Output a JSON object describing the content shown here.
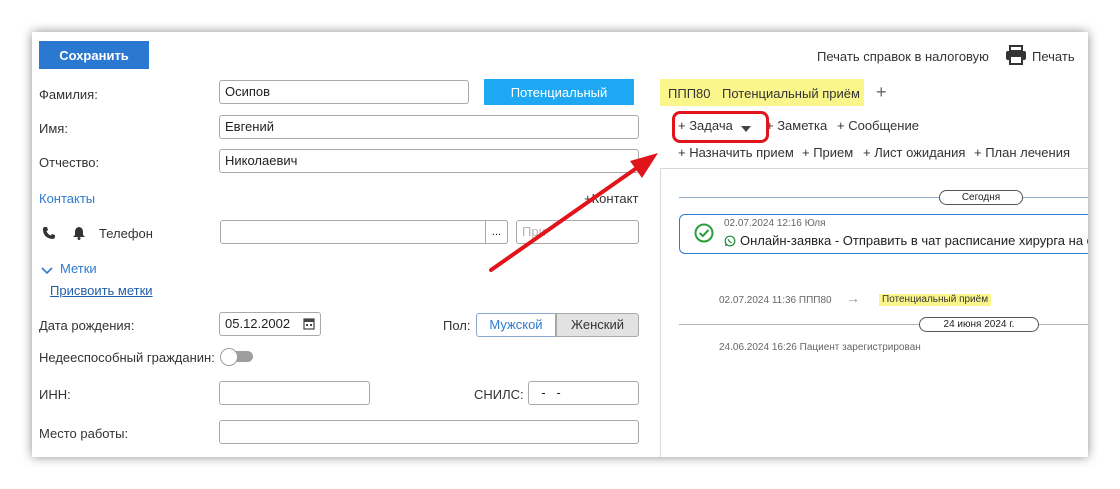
{
  "toolbar": {
    "save_label": "Сохранить",
    "print_tax_label": "Печать справок в налоговую",
    "print_label": "Печать"
  },
  "form": {
    "last_name_label": "Фамилия:",
    "last_name_value": "Осипов",
    "first_name_label": "Имя:",
    "first_name_value": "Евгений",
    "patronymic_label": "Отчество:",
    "patronymic_value": "Николаевич",
    "status_button": "Потенциальный",
    "contacts_label": "Контакты",
    "add_contact_label": "+Контакт",
    "phone_label": "Телефон",
    "phone_value": "",
    "phone_dots": "...",
    "phone_note_placeholder": "При",
    "tags_label": "Метки",
    "assign_tags_label": "Присвоить метки",
    "birth_date_label": "Дата рождения:",
    "birth_date_value": "05.12.2002",
    "gender_label": "Пол:",
    "gender_male": "Мужской",
    "gender_female": "Женский",
    "incapable_label": "Недееспособный гражданин:",
    "inn_label": "ИНН:",
    "inn_value": "",
    "snils_label": "СНИЛС:",
    "snils_value": "  -   -",
    "workplace_label": "Место работы:",
    "workplace_value": ""
  },
  "right": {
    "funnel_tag_code": "ППП80",
    "funnel_tag_name": "Потенциальный приём",
    "add_tag_symbol": "+",
    "actions_row1": [
      "+ Задача",
      "+ Заметка",
      "+ Сообщение"
    ],
    "actions_row2": [
      "+ Назначить прием",
      "+ Прием",
      "+ Лист ожидания",
      "+ План лечения"
    ]
  },
  "timeline": {
    "today_label": "Сегодня",
    "event1_meta": "02.07.2024 12:16 Юля",
    "event1_text": "Онлайн-заявка - Отправить в чат расписание хирурга на с",
    "event2_meta": "02.07.2024 11:36 ППП80",
    "event2_arrow": "→",
    "event2_stage": "Потенциальный приём",
    "date_separator": "24 июня 2024 г.",
    "event3_meta": "24.06.2024 16:26 Пациент зарегистрирован"
  },
  "colors": {
    "primary": "#2b78d0",
    "status": "#1ea7f2",
    "highlight": "#fbf68c",
    "annotation_red": "#e0141a",
    "success": "#2a9d3c"
  }
}
